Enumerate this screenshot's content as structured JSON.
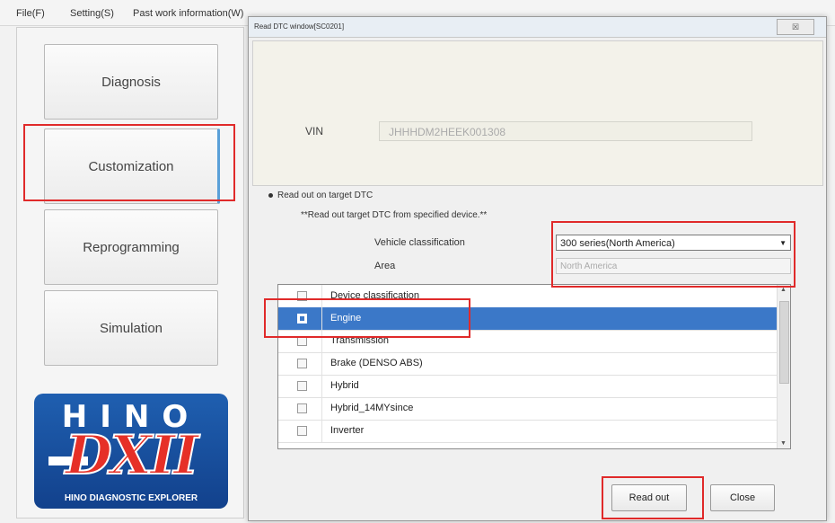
{
  "menubar": {
    "file": "File(F)",
    "setting": "Setting(S)",
    "past_work": "Past work information(W)"
  },
  "nav": {
    "diagnosis": "Diagnosis",
    "customization": "Customization",
    "reprogramming": "Reprogramming",
    "simulation": "Simulation"
  },
  "logo": {
    "brand": "HINO",
    "product": "DXII",
    "tagline": "HINO DIAGNOSTIC EXPLORER"
  },
  "dialog": {
    "title": "Read DTC window[SC0201]",
    "close_glyph": "☒",
    "vin_label": "VIN",
    "vin_value": "JHHHDM2HEEK001308",
    "radio_label": "Read out on target DTC",
    "subheading": "**Read out target DTC from specified device.**",
    "vehicle_class_label": "Vehicle classification",
    "vehicle_class_value": "300 series(North America)",
    "area_label": "Area",
    "area_value": "North America",
    "list_header": "Device classification",
    "devices": [
      {
        "name": "Engine",
        "checked": true
      },
      {
        "name": "Transmission",
        "checked": false
      },
      {
        "name": "Brake (DENSO ABS)",
        "checked": false
      },
      {
        "name": "Hybrid",
        "checked": false
      },
      {
        "name": "Hybrid_14MYsince",
        "checked": false
      },
      {
        "name": "Inverter",
        "checked": false
      }
    ],
    "read_out_button": "Read out",
    "close_button": "Close"
  },
  "colors": {
    "highlight_box": "#e02a2a",
    "selection": "#3b78c8",
    "logo_blue": "#1f5fb0"
  }
}
